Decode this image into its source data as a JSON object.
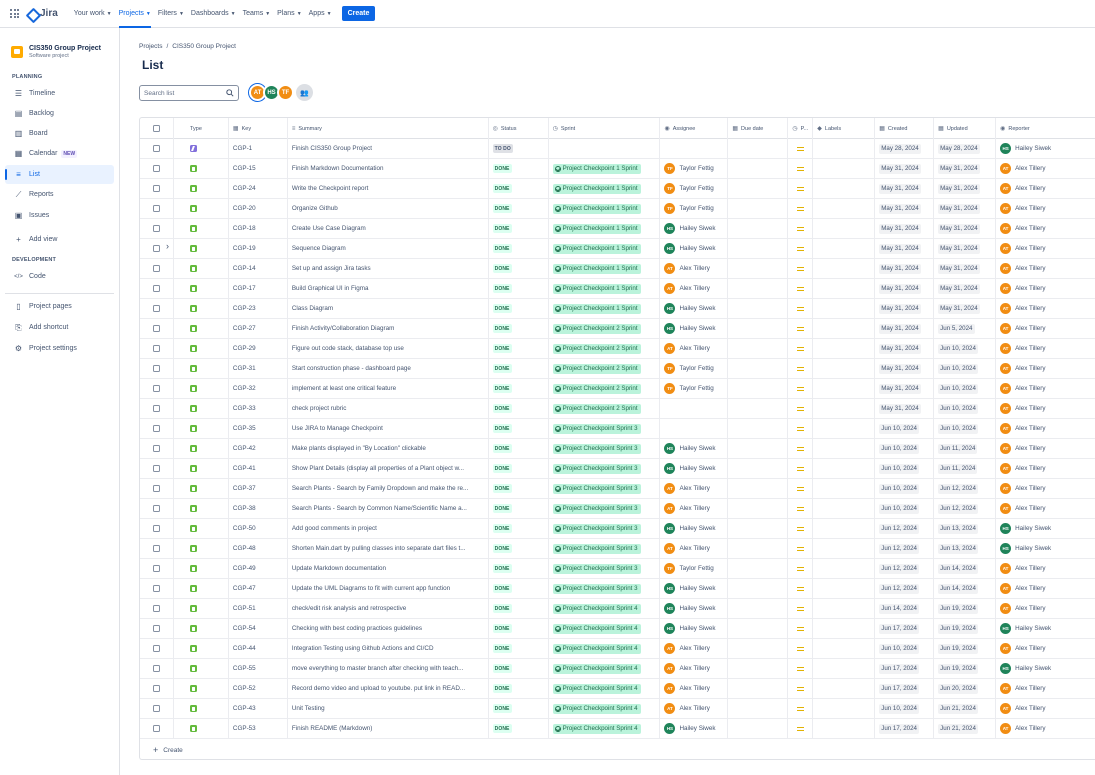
{
  "nav": {
    "logo": "Jira",
    "items": [
      {
        "label": "Your work",
        "active": false
      },
      {
        "label": "Projects",
        "active": true
      },
      {
        "label": "Filters",
        "active": false
      },
      {
        "label": "Dashboards",
        "active": false
      },
      {
        "label": "Teams",
        "active": false
      },
      {
        "label": "Plans",
        "active": false
      },
      {
        "label": "Apps",
        "active": false
      }
    ],
    "create": "Create"
  },
  "sidebar": {
    "project_name": "CIS350 Group Project",
    "project_type": "Software project",
    "planning_label": "PLANNING",
    "development_label": "DEVELOPMENT",
    "planning_items": [
      {
        "label": "Timeline",
        "icon": "timeline-icon"
      },
      {
        "label": "Backlog",
        "icon": "backlog-icon"
      },
      {
        "label": "Board",
        "icon": "board-icon"
      },
      {
        "label": "Calendar",
        "icon": "calendar-icon",
        "badge": "NEW"
      },
      {
        "label": "List",
        "icon": "list-icon",
        "selected": true
      },
      {
        "label": "Reports",
        "icon": "reports-icon"
      },
      {
        "label": "Issues",
        "icon": "issues-icon"
      },
      {
        "label": "Add view",
        "icon": "plus-icon"
      }
    ],
    "development_items": [
      {
        "label": "Code",
        "icon": "code-icon"
      }
    ],
    "bottom_items": [
      {
        "label": "Project pages",
        "icon": "pages-icon"
      },
      {
        "label": "Add shortcut",
        "icon": "shortcut-icon"
      },
      {
        "label": "Project settings",
        "icon": "gear-icon"
      }
    ]
  },
  "breadcrumb": [
    "Projects",
    "/",
    "CIS350 Group Project"
  ],
  "page_title": "List",
  "search": {
    "placeholder": "Search list"
  },
  "avatars": [
    {
      "initials": "AT",
      "color": "#f18d13"
    },
    {
      "initials": "HS",
      "color": "#1f845a"
    },
    {
      "initials": "TF",
      "color": "#f18d13"
    }
  ],
  "colors": {
    "AT": "#f18d13",
    "HS": "#1f845a",
    "TF": "#f18d13"
  },
  "columns": [
    "Type",
    "Key",
    "Summary",
    "Status",
    "Sprint",
    "Assignee",
    "Due date",
    "P...",
    "Labels",
    "Created",
    "Updated",
    "Reporter"
  ],
  "rows": [
    {
      "type": "epic",
      "key": "CGP-1",
      "summary": "Finish CIS350 Group Project",
      "status": "TO DO",
      "sprint": "",
      "assignee": "",
      "assignee_initials": "",
      "created": "May 28, 2024",
      "updated": "May 28, 2024",
      "reporter": "Hailey Siwek",
      "reporter_initials": "HS"
    },
    {
      "type": "story",
      "key": "CGP-15",
      "summary": "Finish Markdown Documentation",
      "status": "DONE",
      "sprint": "Project Checkpoint 1 Sprint",
      "assignee": "Taylor Fettig",
      "assignee_initials": "TF",
      "created": "May 31, 2024",
      "updated": "May 31, 2024",
      "reporter": "Alex Tillery",
      "reporter_initials": "AT"
    },
    {
      "type": "story",
      "key": "CGP-24",
      "summary": "Write the Checkpoint report",
      "status": "DONE",
      "sprint": "Project Checkpoint 1 Sprint",
      "assignee": "Taylor Fettig",
      "assignee_initials": "TF",
      "created": "May 31, 2024",
      "updated": "May 31, 2024",
      "reporter": "Alex Tillery",
      "reporter_initials": "AT"
    },
    {
      "type": "story",
      "key": "CGP-20",
      "summary": "Organize Github",
      "status": "DONE",
      "sprint": "Project Checkpoint 1 Sprint",
      "assignee": "Taylor Fettig",
      "assignee_initials": "TF",
      "created": "May 31, 2024",
      "updated": "May 31, 2024",
      "reporter": "Alex Tillery",
      "reporter_initials": "AT"
    },
    {
      "type": "story",
      "key": "CGP-18",
      "summary": "Create Use Case Diagram",
      "status": "DONE",
      "sprint": "Project Checkpoint 1 Sprint",
      "assignee": "Hailey Siwek",
      "assignee_initials": "HS",
      "created": "May 31, 2024",
      "updated": "May 31, 2024",
      "reporter": "Alex Tillery",
      "reporter_initials": "AT"
    },
    {
      "type": "story",
      "key": "CGP-19",
      "summary": "Sequence Diagram",
      "status": "DONE",
      "sprint": "Project Checkpoint 1 Sprint",
      "assignee": "Hailey Siwek",
      "assignee_initials": "HS",
      "created": "May 31, 2024",
      "updated": "May 31, 2024",
      "reporter": "Alex Tillery",
      "reporter_initials": "AT",
      "expandable": true
    },
    {
      "type": "story",
      "key": "CGP-14",
      "summary": "Set up and assign Jira tasks",
      "status": "DONE",
      "sprint": "Project Checkpoint 1 Sprint",
      "assignee": "Alex Tillery",
      "assignee_initials": "AT",
      "created": "May 31, 2024",
      "updated": "May 31, 2024",
      "reporter": "Alex Tillery",
      "reporter_initials": "AT"
    },
    {
      "type": "story",
      "key": "CGP-17",
      "summary": "Build Graphical UI in Figma",
      "status": "DONE",
      "sprint": "Project Checkpoint 1 Sprint",
      "assignee": "Alex Tillery",
      "assignee_initials": "AT",
      "created": "May 31, 2024",
      "updated": "May 31, 2024",
      "reporter": "Alex Tillery",
      "reporter_initials": "AT"
    },
    {
      "type": "story",
      "key": "CGP-23",
      "summary": "Class Diagram",
      "status": "DONE",
      "sprint": "Project Checkpoint 1 Sprint",
      "assignee": "Hailey Siwek",
      "assignee_initials": "HS",
      "created": "May 31, 2024",
      "updated": "May 31, 2024",
      "reporter": "Alex Tillery",
      "reporter_initials": "AT"
    },
    {
      "type": "story",
      "key": "CGP-27",
      "summary": "Finish Activity/Collaboration Diagram",
      "status": "DONE",
      "sprint": "Project Checkpoint 2 Sprint",
      "assignee": "Hailey Siwek",
      "assignee_initials": "HS",
      "created": "May 31, 2024",
      "updated": "Jun 5, 2024",
      "reporter": "Alex Tillery",
      "reporter_initials": "AT"
    },
    {
      "type": "story",
      "key": "CGP-29",
      "summary": "Figure out code stack, database top use",
      "status": "DONE",
      "sprint": "Project Checkpoint 2 Sprint",
      "assignee": "Alex Tillery",
      "assignee_initials": "AT",
      "created": "May 31, 2024",
      "updated": "Jun 10, 2024",
      "reporter": "Alex Tillery",
      "reporter_initials": "AT"
    },
    {
      "type": "story",
      "key": "CGP-31",
      "summary": "Start construction phase - dashboard page",
      "status": "DONE",
      "sprint": "Project Checkpoint 2 Sprint",
      "assignee": "Taylor Fettig",
      "assignee_initials": "TF",
      "created": "May 31, 2024",
      "updated": "Jun 10, 2024",
      "reporter": "Alex Tillery",
      "reporter_initials": "AT"
    },
    {
      "type": "story",
      "key": "CGP-32",
      "summary": "implement at least one critical feature",
      "status": "DONE",
      "sprint": "Project Checkpoint 2 Sprint",
      "assignee": "Taylor Fettig",
      "assignee_initials": "TF",
      "created": "May 31, 2024",
      "updated": "Jun 10, 2024",
      "reporter": "Alex Tillery",
      "reporter_initials": "AT"
    },
    {
      "type": "story",
      "key": "CGP-33",
      "summary": "check project rubric",
      "status": "DONE",
      "sprint": "Project Checkpoint 2 Sprint",
      "assignee": "",
      "assignee_initials": "",
      "created": "May 31, 2024",
      "updated": "Jun 10, 2024",
      "reporter": "Alex Tillery",
      "reporter_initials": "AT"
    },
    {
      "type": "story",
      "key": "CGP-35",
      "summary": "Use JIRA to Manage Checkpoint",
      "status": "DONE",
      "sprint": "Project Checkpoint Sprint 3",
      "assignee": "",
      "assignee_initials": "",
      "created": "Jun 10, 2024",
      "updated": "Jun 10, 2024",
      "reporter": "Alex Tillery",
      "reporter_initials": "AT"
    },
    {
      "type": "story",
      "key": "CGP-42",
      "summary": "Make plants displayed in \"By Location\" clickable",
      "status": "DONE",
      "sprint": "Project Checkpoint Sprint 3",
      "assignee": "Hailey Siwek",
      "assignee_initials": "HS",
      "created": "Jun 10, 2024",
      "updated": "Jun 11, 2024",
      "reporter": "Alex Tillery",
      "reporter_initials": "AT"
    },
    {
      "type": "story",
      "key": "CGP-41",
      "summary": "Show Plant Details (display all properties of a Plant object w...",
      "status": "DONE",
      "sprint": "Project Checkpoint Sprint 3",
      "assignee": "Hailey Siwek",
      "assignee_initials": "HS",
      "created": "Jun 10, 2024",
      "updated": "Jun 11, 2024",
      "reporter": "Alex Tillery",
      "reporter_initials": "AT"
    },
    {
      "type": "story",
      "key": "CGP-37",
      "summary": "Search Plants - Search by Family Dropdown and make the re...",
      "status": "DONE",
      "sprint": "Project Checkpoint Sprint 3",
      "assignee": "Alex Tillery",
      "assignee_initials": "AT",
      "created": "Jun 10, 2024",
      "updated": "Jun 12, 2024",
      "reporter": "Alex Tillery",
      "reporter_initials": "AT"
    },
    {
      "type": "story",
      "key": "CGP-38",
      "summary": "Search Plants - Search by Common Name/Scientific Name a...",
      "status": "DONE",
      "sprint": "Project Checkpoint Sprint 3",
      "assignee": "Alex Tillery",
      "assignee_initials": "AT",
      "created": "Jun 10, 2024",
      "updated": "Jun 12, 2024",
      "reporter": "Alex Tillery",
      "reporter_initials": "AT"
    },
    {
      "type": "story",
      "key": "CGP-50",
      "summary": "Add good comments in project",
      "status": "DONE",
      "sprint": "Project Checkpoint Sprint 3",
      "assignee": "Hailey Siwek",
      "assignee_initials": "HS",
      "created": "Jun 12, 2024",
      "updated": "Jun 13, 2024",
      "reporter": "Hailey Siwek",
      "reporter_initials": "HS"
    },
    {
      "type": "story",
      "key": "CGP-48",
      "summary": "Shorten Main.dart by pulling classes into separate dart files t...",
      "status": "DONE",
      "sprint": "Project Checkpoint Sprint 3",
      "assignee": "Alex Tillery",
      "assignee_initials": "AT",
      "created": "Jun 12, 2024",
      "updated": "Jun 13, 2024",
      "reporter": "Hailey Siwek",
      "reporter_initials": "HS"
    },
    {
      "type": "story",
      "key": "CGP-49",
      "summary": "Update Markdown documentation",
      "status": "DONE",
      "sprint": "Project Checkpoint Sprint 3",
      "assignee": "Taylor Fettig",
      "assignee_initials": "TF",
      "created": "Jun 12, 2024",
      "updated": "Jun 14, 2024",
      "reporter": "Alex Tillery",
      "reporter_initials": "AT"
    },
    {
      "type": "story",
      "key": "CGP-47",
      "summary": "Update the UML Diagrams to fit with current app function",
      "status": "DONE",
      "sprint": "Project Checkpoint Sprint 3",
      "assignee": "Hailey Siwek",
      "assignee_initials": "HS",
      "created": "Jun 12, 2024",
      "updated": "Jun 14, 2024",
      "reporter": "Alex Tillery",
      "reporter_initials": "AT"
    },
    {
      "type": "story",
      "key": "CGP-51",
      "summary": "check/edit risk analysis and retrospective",
      "status": "DONE",
      "sprint": "Project Checkpoint Sprint 4",
      "assignee": "Hailey Siwek",
      "assignee_initials": "HS",
      "created": "Jun 14, 2024",
      "updated": "Jun 19, 2024",
      "reporter": "Alex Tillery",
      "reporter_initials": "AT"
    },
    {
      "type": "story",
      "key": "CGP-54",
      "summary": "Checking with best coding practices guidelines",
      "status": "DONE",
      "sprint": "Project Checkpoint Sprint 4",
      "assignee": "Hailey Siwek",
      "assignee_initials": "HS",
      "created": "Jun 17, 2024",
      "updated": "Jun 19, 2024",
      "reporter": "Hailey Siwek",
      "reporter_initials": "HS"
    },
    {
      "type": "story",
      "key": "CGP-44",
      "summary": "Integration Testing using Github Actions and CI/CD",
      "status": "DONE",
      "sprint": "Project Checkpoint Sprint 4",
      "assignee": "Alex Tillery",
      "assignee_initials": "AT",
      "created": "Jun 10, 2024",
      "updated": "Jun 19, 2024",
      "reporter": "Alex Tillery",
      "reporter_initials": "AT"
    },
    {
      "type": "story",
      "key": "CGP-55",
      "summary": "move everything to master branch after checking with teach...",
      "status": "DONE",
      "sprint": "Project Checkpoint Sprint 4",
      "assignee": "Alex Tillery",
      "assignee_initials": "AT",
      "created": "Jun 17, 2024",
      "updated": "Jun 19, 2024",
      "reporter": "Hailey Siwek",
      "reporter_initials": "HS"
    },
    {
      "type": "story",
      "key": "CGP-52",
      "summary": "Record demo video and upload to youtube. put link in READ...",
      "status": "DONE",
      "sprint": "Project Checkpoint Sprint 4",
      "assignee": "Alex Tillery",
      "assignee_initials": "AT",
      "created": "Jun 17, 2024",
      "updated": "Jun 20, 2024",
      "reporter": "Alex Tillery",
      "reporter_initials": "AT"
    },
    {
      "type": "story",
      "key": "CGP-43",
      "summary": "Unit Testing",
      "status": "DONE",
      "sprint": "Project Checkpoint Sprint 4",
      "assignee": "Alex Tillery",
      "assignee_initials": "AT",
      "created": "Jun 10, 2024",
      "updated": "Jun 21, 2024",
      "reporter": "Alex Tillery",
      "reporter_initials": "AT"
    },
    {
      "type": "story",
      "key": "CGP-53",
      "summary": "Finish README (Markdown)",
      "status": "DONE",
      "sprint": "Project Checkpoint Sprint 4",
      "assignee": "Hailey Siwek",
      "assignee_initials": "HS",
      "created": "Jun 17, 2024",
      "updated": "Jun 21, 2024",
      "reporter": "Alex Tillery",
      "reporter_initials": "AT"
    }
  ],
  "create_row": "Create"
}
